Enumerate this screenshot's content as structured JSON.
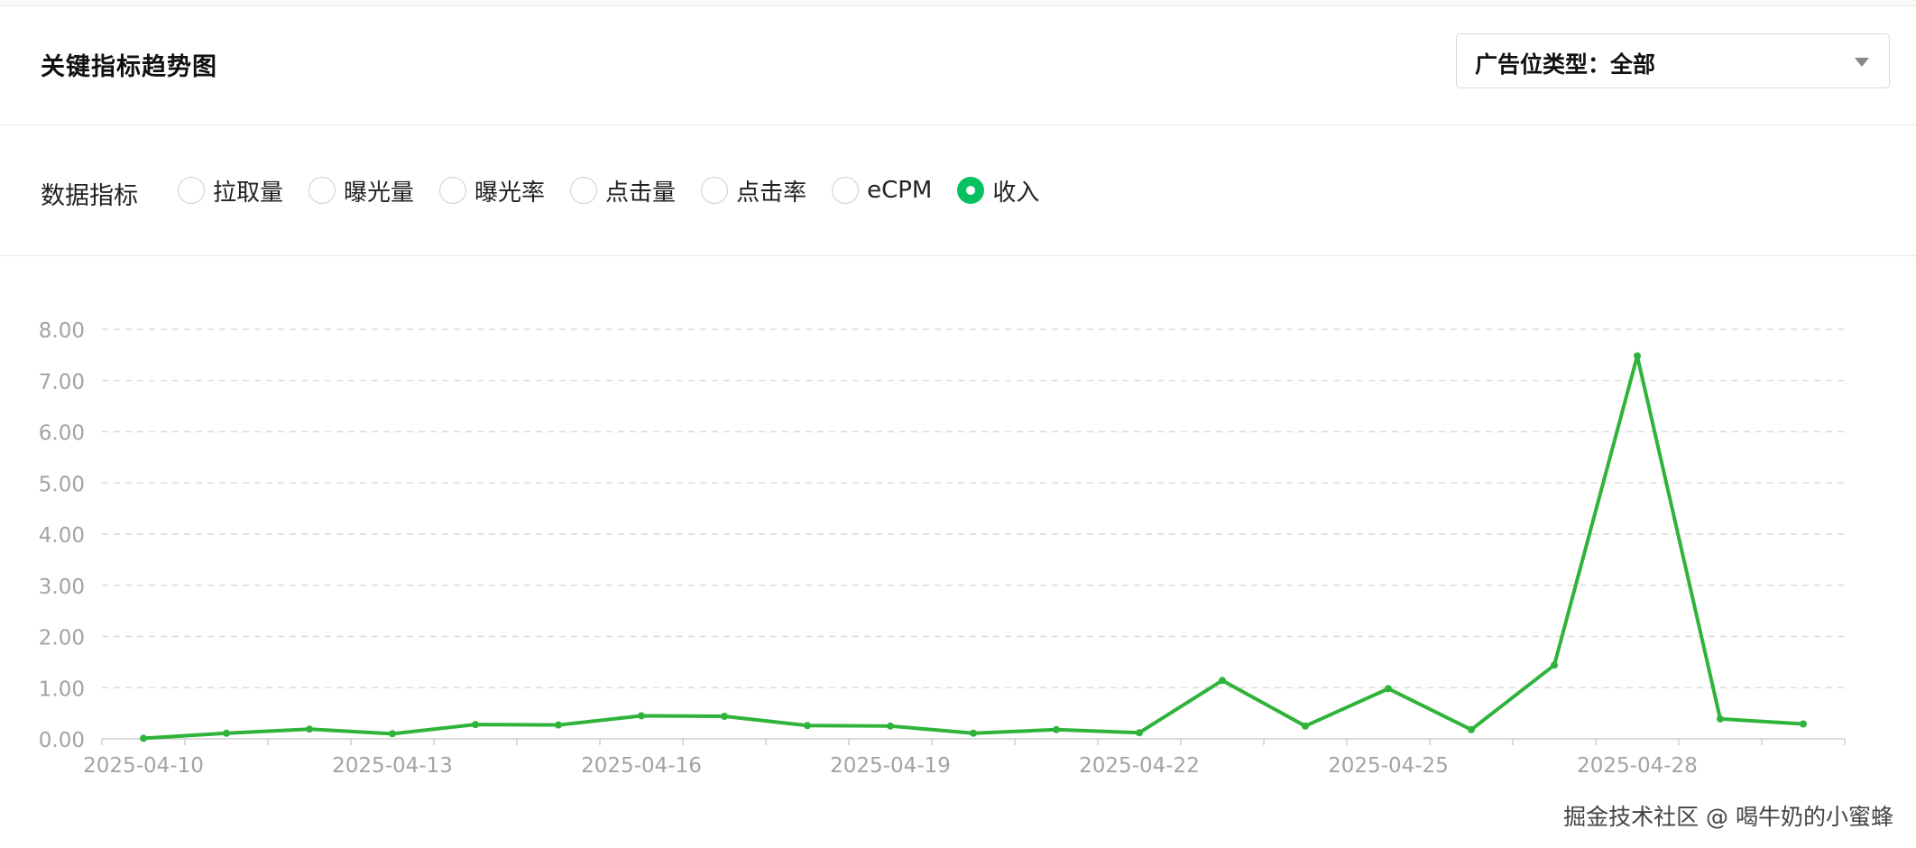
{
  "header": {
    "title": "关键指标趋势图",
    "ad_type_select": "广告位类型：全部"
  },
  "metrics": {
    "label": "数据指标",
    "options": [
      "拉取量",
      "曝光量",
      "曝光率",
      "点击量",
      "点击率",
      "eCPM",
      "收入"
    ],
    "selected": "收入"
  },
  "colors": {
    "accent": "#07c160",
    "line": "#2fb33a",
    "axis_text": "#a3a3a3",
    "grid": "#dcdcdc"
  },
  "watermark": "掘金技术社区 @ 喝牛奶的小蜜蜂",
  "chart_data": {
    "type": "line",
    "title": "",
    "xlabel": "",
    "ylabel": "",
    "ylim": [
      0,
      8
    ],
    "yticks": [
      "0.00",
      "1.00",
      "2.00",
      "3.00",
      "4.00",
      "5.00",
      "6.00",
      "7.00",
      "8.00"
    ],
    "grid": true,
    "x": [
      "2025-04-10",
      "2025-04-11",
      "2025-04-12",
      "2025-04-13",
      "2025-04-14",
      "2025-04-15",
      "2025-04-16",
      "2025-04-17",
      "2025-04-18",
      "2025-04-19",
      "2025-04-20",
      "2025-04-21",
      "2025-04-22",
      "2025-04-23",
      "2025-04-24",
      "2025-04-25",
      "2025-04-26",
      "2025-04-27",
      "2025-04-28",
      "2025-04-29",
      "2025-04-30"
    ],
    "xtick_labels": [
      "2025-04-10",
      "2025-04-13",
      "2025-04-16",
      "2025-04-19",
      "2025-04-22",
      "2025-04-25",
      "2025-04-28"
    ],
    "series": [
      {
        "values": [
          0.01,
          0.11,
          0.19,
          0.1,
          0.28,
          0.27,
          0.45,
          0.44,
          0.26,
          0.25,
          0.11,
          0.18,
          0.12,
          1.14,
          0.25,
          0.98,
          0.18,
          1.44,
          7.48,
          0.39,
          0.29
        ]
      }
    ]
  }
}
